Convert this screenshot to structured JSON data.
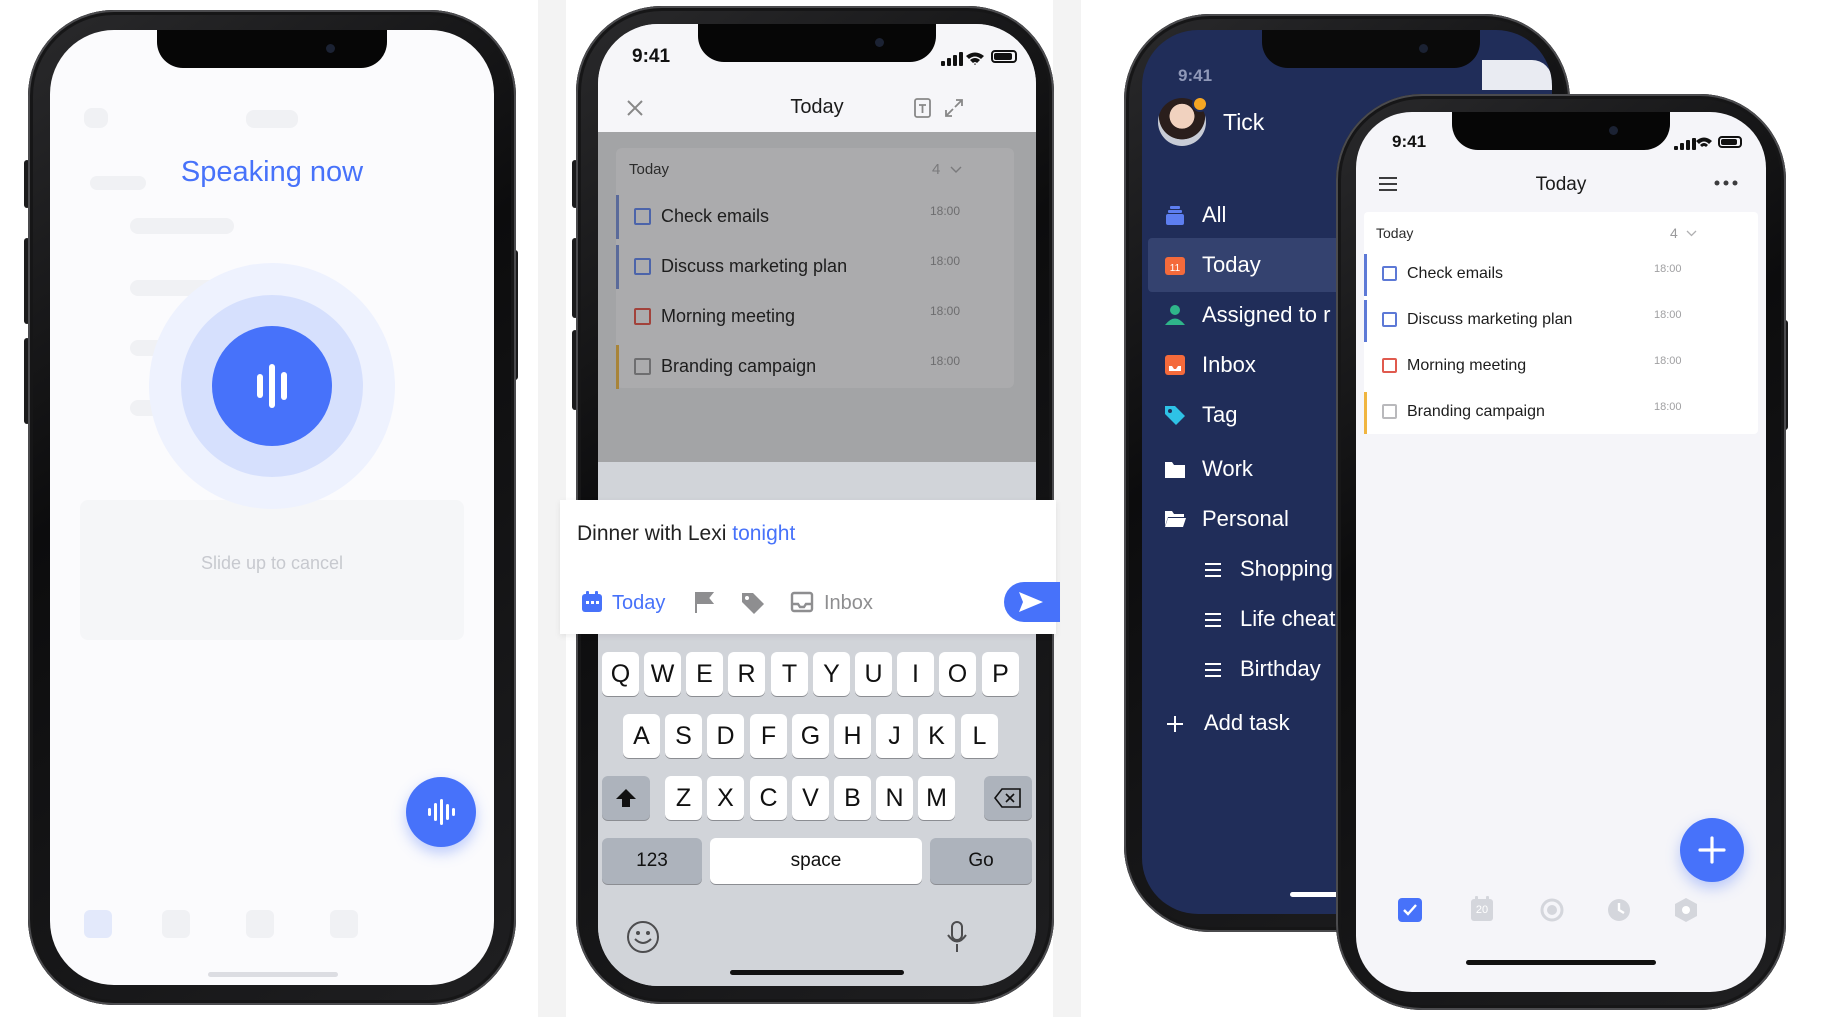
{
  "phone1": {
    "title": "Speaking now",
    "cancel_hint": "Slide up to cancel",
    "accent": "#4772fa"
  },
  "phone2": {
    "status_time": "9:41",
    "header": {
      "title": "Today"
    },
    "list": {
      "section_title": "Today",
      "count": "4",
      "tasks": [
        {
          "title": "Check emails",
          "time": "18:00",
          "priority_color": "#5d79d6"
        },
        {
          "title": "Discuss marketing plan",
          "time": "18:00",
          "priority_color": "#5d79d6"
        },
        {
          "title": "Morning meeting",
          "time": "18:00",
          "priority_color": "#c9463c"
        },
        {
          "title": "Branding campaign",
          "time": "18:00",
          "priority_color": "#d8a23b"
        }
      ]
    },
    "composer": {
      "text": "Dinner with Lexi ",
      "highlight": "tonight",
      "date_label": "Today",
      "list_label": "Inbox"
    },
    "keyboard": {
      "row1": [
        "Q",
        "W",
        "E",
        "R",
        "T",
        "Y",
        "U",
        "I",
        "O",
        "P"
      ],
      "row2": [
        "A",
        "S",
        "D",
        "F",
        "G",
        "H",
        "J",
        "K",
        "L"
      ],
      "row3": [
        "Z",
        "X",
        "C",
        "V",
        "B",
        "N",
        "M"
      ],
      "numbers_key": "123",
      "space_key": "space",
      "go_key": "Go"
    }
  },
  "phone3": {
    "status_time": "9:41",
    "user_name": "Tick",
    "sidebar_bg": "#202d59",
    "nav": [
      {
        "label": "All",
        "icon": "stack-icon"
      },
      {
        "label": "Today",
        "icon": "calendar-icon"
      },
      {
        "label": "Assigned to r",
        "icon": "person-icon"
      },
      {
        "label": "Inbox",
        "icon": "inbox-icon"
      },
      {
        "label": "Tag",
        "icon": "tag-icon"
      },
      {
        "label": "Work",
        "icon": "folder-icon"
      },
      {
        "label": "Personal",
        "icon": "folder-open-icon"
      }
    ],
    "sub_lists": [
      "Shopping",
      "Life cheat",
      "Birthday"
    ],
    "add_task": "Add task"
  },
  "phone4": {
    "status_time": "9:41",
    "header": {
      "title": "Today"
    },
    "list": {
      "section_title": "Today",
      "count": "4",
      "tasks": [
        {
          "title": "Check emails",
          "time": "18:00",
          "priority_color": "#5d79d6"
        },
        {
          "title": "Discuss marketing plan",
          "time": "18:00",
          "priority_color": "#5d79d6"
        },
        {
          "title": "Morning meeting",
          "time": "18:00",
          "priority_color": "#e05a4e"
        },
        {
          "title": "Branding campaign",
          "time": "18:00",
          "priority_color": "#f0b540"
        }
      ]
    },
    "tabbar": {
      "calendar_day": "20"
    }
  }
}
